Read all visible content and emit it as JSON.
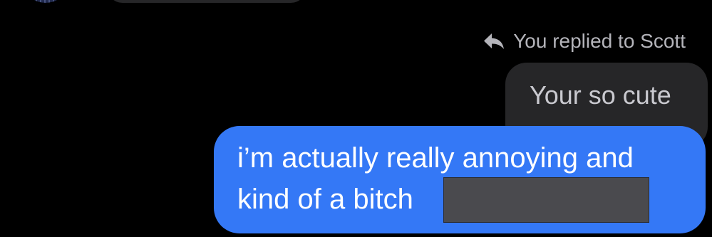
{
  "conversation": {
    "reply_header": {
      "label": "You replied to Scott",
      "icon": "reply-arrow-icon"
    },
    "quoted_message": {
      "text": "Your so cute"
    },
    "sent_message": {
      "line1": "i’m actually really annoying and",
      "line2": "kind of a bitch"
    }
  },
  "colors": {
    "background": "#000000",
    "sent_bubble": "#3478f6",
    "quoted_bubble": "#262628",
    "reply_header_text": "#b4b4ba",
    "redaction": "#4a4a4e"
  }
}
